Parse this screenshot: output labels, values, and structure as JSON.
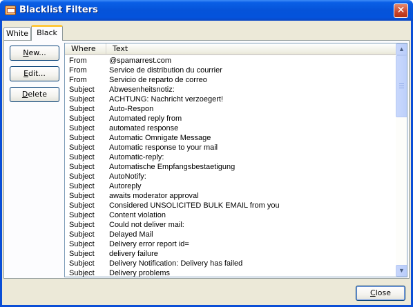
{
  "window": {
    "title": "Blacklist Filters",
    "close_glyph": "✕"
  },
  "tabs": [
    {
      "label": "White",
      "active": false
    },
    {
      "label": "Black",
      "active": true
    }
  ],
  "buttons": {
    "new": {
      "accel": "N",
      "rest": "ew..."
    },
    "edit": {
      "accel": "E",
      "rest": "dit..."
    },
    "delete": {
      "accel": "D",
      "rest": "elete"
    },
    "close": {
      "accel": "C",
      "rest": "lose"
    }
  },
  "list": {
    "columns": [
      "Where",
      "Text"
    ],
    "rows": [
      {
        "where": "From",
        "text": "@spamarrest.com"
      },
      {
        "where": "From",
        "text": "Service de distribution du courrier"
      },
      {
        "where": "From",
        "text": "Servicio de reparto de correo"
      },
      {
        "where": "Subject",
        "text": "Abwesenheitsnotiz:"
      },
      {
        "where": "Subject",
        "text": "ACHTUNG: Nachricht verzoegert!"
      },
      {
        "where": "Subject",
        "text": "Auto-Respon"
      },
      {
        "where": "Subject",
        "text": "Automated reply from"
      },
      {
        "where": "Subject",
        "text": "automated response"
      },
      {
        "where": "Subject",
        "text": "Automatic Omnigate Message"
      },
      {
        "where": "Subject",
        "text": "Automatic response to your mail"
      },
      {
        "where": "Subject",
        "text": "Automatic-reply:"
      },
      {
        "where": "Subject",
        "text": "Automatische Empfangsbestaetigung"
      },
      {
        "where": "Subject",
        "text": "AutoNotify:"
      },
      {
        "where": "Subject",
        "text": "Autoreply"
      },
      {
        "where": "Subject",
        "text": "awaits moderator approval"
      },
      {
        "where": "Subject",
        "text": "Considered UNSOLICITED BULK EMAIL from you"
      },
      {
        "where": "Subject",
        "text": "Content violation"
      },
      {
        "where": "Subject",
        "text": "Could not deliver mail:"
      },
      {
        "where": "Subject",
        "text": "Delayed Mail"
      },
      {
        "where": "Subject",
        "text": "Delivery error report id="
      },
      {
        "where": "Subject",
        "text": "delivery failure"
      },
      {
        "where": "Subject",
        "text": "Delivery Notification: Delivery has failed"
      },
      {
        "where": "Subject",
        "text": "Delivery problems"
      }
    ]
  },
  "scrollbar": {
    "up_glyph": "▲",
    "down_glyph": "▼"
  }
}
